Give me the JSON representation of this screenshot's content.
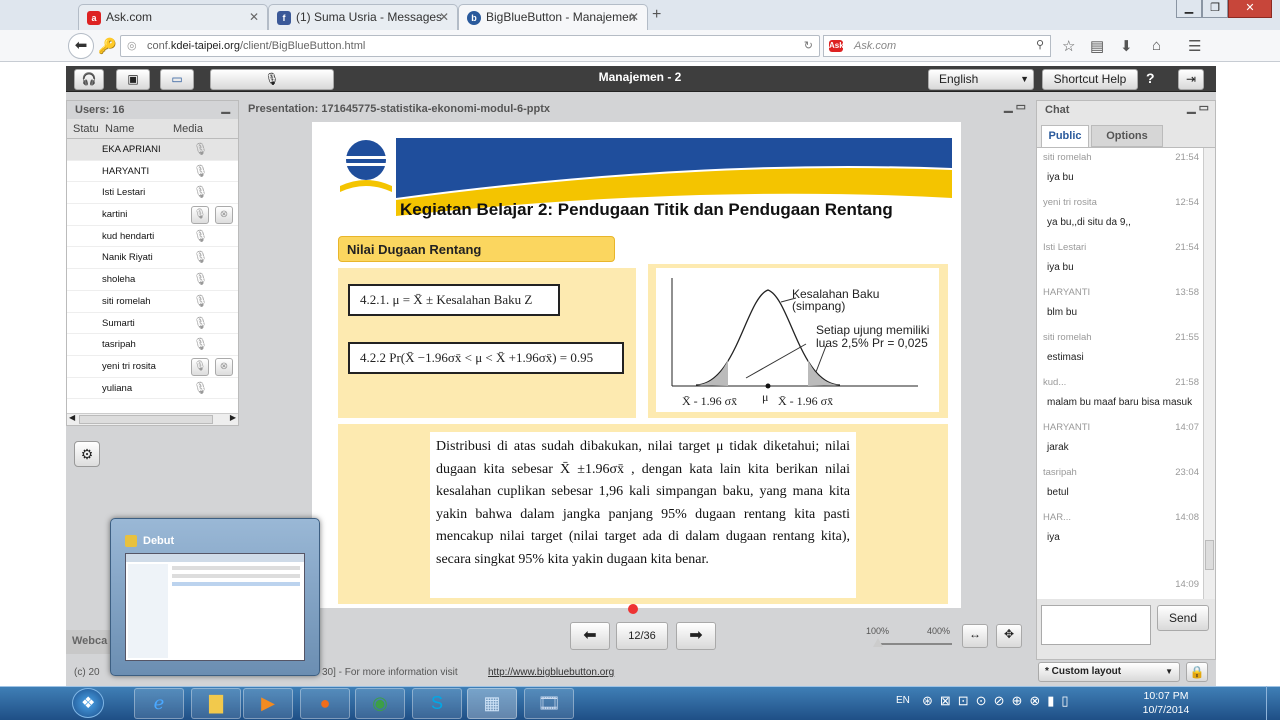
{
  "browser": {
    "tabs": [
      {
        "label": "Ask.com",
        "icon": "ask-icon"
      },
      {
        "label": "(1) Suma Usria - Messages",
        "icon": "facebook-icon"
      },
      {
        "label": "BigBlueButton - Manajemen",
        "icon": "bigbluebutton-icon"
      }
    ],
    "new_tab": "+",
    "url_prefix": "conf.",
    "url_domain": "kdei-taipei.org",
    "url_path": "/client/BigBlueButton.html",
    "search_engine": "Ask",
    "search_placeholder": "Ask.com"
  },
  "bbb": {
    "title": "Manajemen - 2",
    "language": "English",
    "shortcut_help": "Shortcut Help",
    "help": "?"
  },
  "users": {
    "header": "Users: 16",
    "col_status": "Statu",
    "col_name": "Name",
    "col_media": "Media",
    "list": [
      {
        "name": "EKA APRIANI"
      },
      {
        "name": "HARYANTI"
      },
      {
        "name": "Isti Lestari"
      },
      {
        "name": "kartini"
      },
      {
        "name": "kud hendarti"
      },
      {
        "name": "Nanik Riyati"
      },
      {
        "name": "sholeha"
      },
      {
        "name": "siti romelah"
      },
      {
        "name": "Sumarti"
      },
      {
        "name": "tasripah"
      },
      {
        "name": "yeni tri rosita"
      },
      {
        "name": "yuliana"
      }
    ]
  },
  "webcam_label": "Webca",
  "presentation": {
    "header": "Presentation: 171645775-statistika-ekonomi-modul-6-pptx",
    "slide_title": "Kegiatan Belajar 2: Pendugaan Titik dan Pendugaan Rentang",
    "section": "Nilai Dugaan Rentang",
    "formula1": "4.2.1. μ = X̄ ± Kesalahan Baku Z",
    "formula2": "4.2.2   Pr(X̄ −1.96σx̄ < μ < X̄ +1.96σx̄) = 0.95",
    "fig_label1": "Kesalahan Baku (simpang)",
    "fig_label2": "Setiap ujung memiliki luas 2,5% Pr = 0,025",
    "fig_left": "X̄ - 1.96 σx̄",
    "fig_mu": "μ",
    "fig_right": "X̄ - 1.96 σx̄",
    "paragraph": "Distribusi di atas sudah dibakukan, nilai target μ tidak diketahui; nilai dugaan kita sebesar X̄ ±1.96σx̄ , dengan kata lain kita berikan nilai kesalahan cuplikan sebesar 1,96 kali simpangan baku, yang mana kita yakin bahwa dalam jangka panjang 95% dugaan rentang kita pasti mencakup nilai target (nilai target ada di dalam dugaan rentang kita), secara singkat 95% kita yakin dugaan kita benar.",
    "page": "12/36",
    "zoom_min": "100%",
    "zoom_max": "400%"
  },
  "chat": {
    "header": "Chat",
    "tab_public": "Public",
    "tab_options": "Options",
    "messages": [
      {
        "who": "siti romelah",
        "time": "21:54",
        "text": "iya bu"
      },
      {
        "who": "yeni tri rosita",
        "time": "12:54",
        "text": "ya bu,,di situ da 9,,"
      },
      {
        "who": "Isti Lestari",
        "time": "21:54",
        "text": "iya bu"
      },
      {
        "who": "HARYANTI",
        "time": "13:58",
        "text": "blm bu"
      },
      {
        "who": "siti romelah",
        "time": "21:55",
        "text": "estimasi"
      },
      {
        "who": "kud...",
        "time": "21:58",
        "text": "malam bu maaf baru bisa masuk"
      },
      {
        "who": "HARYANTI",
        "time": "14:07",
        "text": "jarak"
      },
      {
        "who": "tasripah",
        "time": "23:04",
        "text": "betul"
      },
      {
        "who": "HAR...",
        "time": "14:08",
        "text": "iya"
      }
    ],
    "last_time": "14:09",
    "send": "Send"
  },
  "footer": {
    "left": "(c) 20",
    "middle": "30] - For more information visit",
    "link": "http://www.bigbluebutton.org",
    "layout": "* Custom layout"
  },
  "thumbnail": {
    "title": "Debut"
  },
  "taskbar": {
    "lang": "EN",
    "time": "10:07 PM",
    "date": "10/7/2014"
  },
  "colors": {
    "bbb_toolbar": "#3e3e3e",
    "slide_yellow": "#fdeab0",
    "slide_blue": "#1f4e9c",
    "taskbar": "#2b5f96"
  }
}
